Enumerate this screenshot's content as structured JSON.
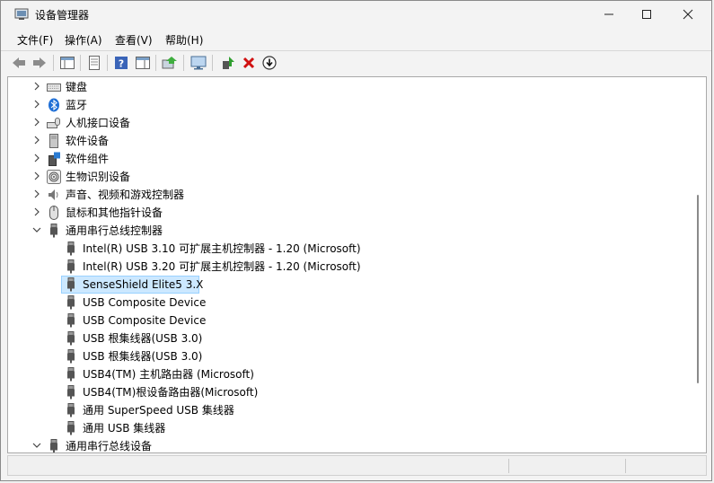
{
  "window": {
    "title": "设备管理器"
  },
  "menu": {
    "file": "文件(F)",
    "action": "操作(A)",
    "view": "查看(V)",
    "help": "帮助(H)"
  },
  "toolbar": {
    "icons": [
      "back-arrow",
      "forward-arrow",
      "show-hide-console-tree",
      "properties",
      "help",
      "action-pane",
      "update-driver",
      "scan-hardware",
      "enable-device",
      "uninstall-device",
      "download-driver"
    ]
  },
  "tree": {
    "keyboard": "键盘",
    "bluetooth": "蓝牙",
    "hid": "人机接口设备",
    "software_devices": "软件设备",
    "software_components": "软件组件",
    "biometric": "生物识别设备",
    "audio": "声音、视频和游戏控制器",
    "mice": "鼠标和其他指针设备",
    "usb_controllers": "通用串行总线控制器",
    "usb_children": [
      "Intel(R) USB 3.10 可扩展主机控制器 - 1.20 (Microsoft)",
      "Intel(R) USB 3.20 可扩展主机控制器 - 1.20 (Microsoft)",
      "SenseShield Elite5 3.X",
      "USB Composite Device",
      "USB Composite Device",
      "USB 根集线器(USB 3.0)",
      "USB 根集线器(USB 3.0)",
      "USB4(TM) 主机路由器 (Microsoft)",
      "USB4(TM)根设备路由器(Microsoft)",
      "通用 SuperSpeed USB 集线器",
      "通用 USB 集线器"
    ],
    "usb_devices": "通用串行总线设备"
  },
  "colors": {
    "selection": "#cce8ff",
    "selection_border": "#99d1ff",
    "delete_red": "#d01010",
    "bluetooth_blue": "#1f6fd6"
  }
}
